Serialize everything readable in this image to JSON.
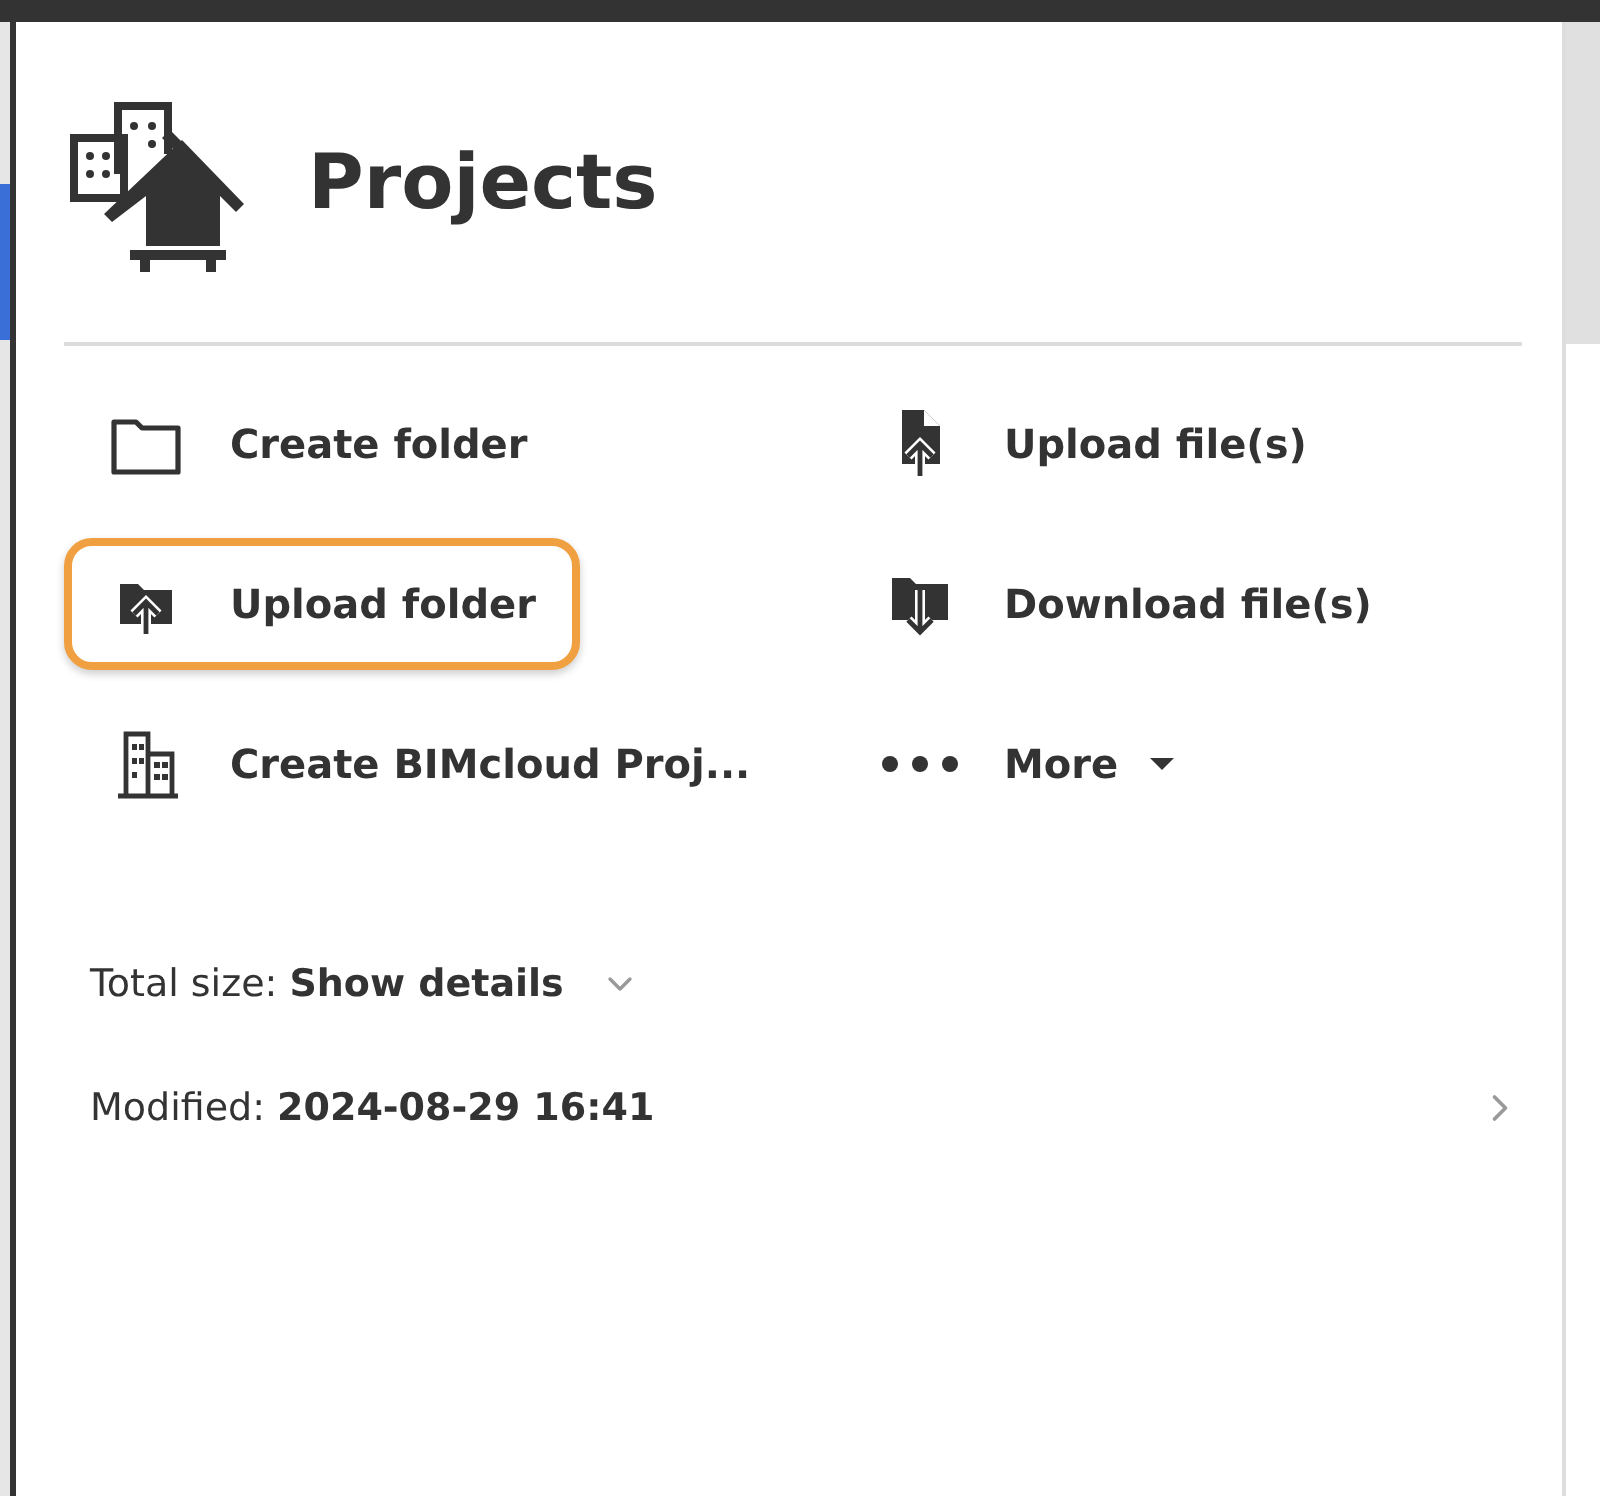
{
  "header": {
    "title": "Projects",
    "kind": "buildings-house"
  },
  "actions": [
    {
      "label": "Create folder",
      "kind": "folder",
      "highlighted": false,
      "dropdown": false
    },
    {
      "label": "Upload file(s)",
      "kind": "file-upload",
      "highlighted": false,
      "dropdown": false
    },
    {
      "label": "Upload folder",
      "kind": "folder-upload",
      "highlighted": true,
      "dropdown": false
    },
    {
      "label": "Download file(s)",
      "kind": "folder-download",
      "highlighted": false,
      "dropdown": false
    },
    {
      "label": "Create BIMcloud Proj...",
      "kind": "building",
      "highlighted": false,
      "dropdown": false
    },
    {
      "label": "More",
      "kind": "dots",
      "highlighted": false,
      "dropdown": true
    }
  ],
  "details": [
    {
      "label": "Total size:",
      "value": "Show details",
      "kind": "expand"
    },
    {
      "label": "Modified:",
      "value": "2024-08-29 16:41",
      "kind": "next"
    }
  ]
}
